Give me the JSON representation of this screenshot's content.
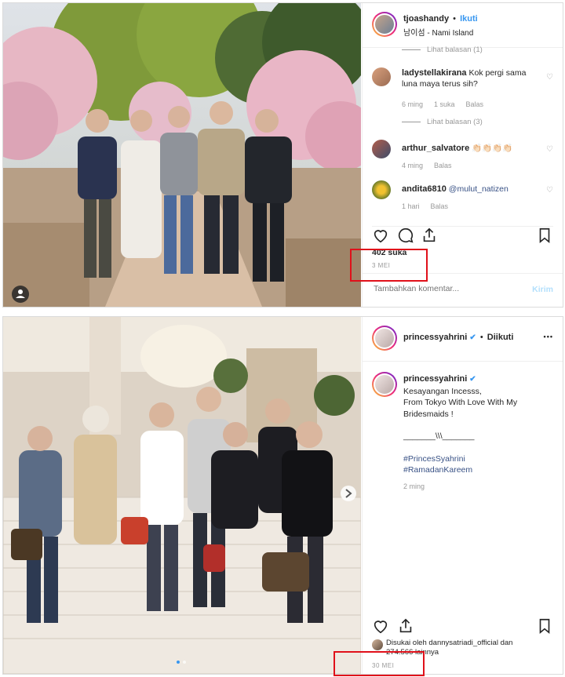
{
  "post1": {
    "username": "tjoashandy",
    "separator": "•",
    "follow_label": "Ikuti",
    "location": "남이섬 - Nami Island",
    "more_label": "•••",
    "top_reply_link": "Lihat balasan (1)",
    "comments": [
      {
        "user": "ladystellakirana",
        "text": "Kok pergi sama luna maya terus sih?",
        "time": "6 ming",
        "likes": "1 suka",
        "reply": "Balas"
      },
      {
        "user": "arthur_salvatore",
        "text": "👏🏻👏🏻👏🏻👏🏻",
        "time": "4 ming",
        "reply": "Balas"
      },
      {
        "user": "andita6810",
        "text": "@mulut_natizen",
        "time": "1 hari",
        "reply": "Balas"
      }
    ],
    "view_replies": "Lihat balasan (3)",
    "likes_text": "402 suka",
    "date": "3 MEI",
    "comment_placeholder": "Tambahkan komentar...",
    "post_label": "Kirim"
  },
  "post2": {
    "username": "princessyahrini",
    "verified": "✔",
    "separator": "•",
    "follow_label": "Diikuti",
    "more_label": "•••",
    "caption_user": "princessyahrini",
    "caption_lines": [
      "Kesayangan Incesss,",
      "From Tokyo With Love With My",
      "Bridesmaids !",
      "",
      "_______\\\\\\_______",
      "",
      "#PrincesSyahrini",
      "#RamadanKareem"
    ],
    "caption_time": "2 ming",
    "liked_by_line1": "Disukai oleh dannysatriadi_official dan",
    "liked_by_line2": "274.566 lainnya",
    "date": "30 MEI"
  },
  "colors": {
    "accent": "#3897f0",
    "highlight_box": "#e0101a"
  }
}
